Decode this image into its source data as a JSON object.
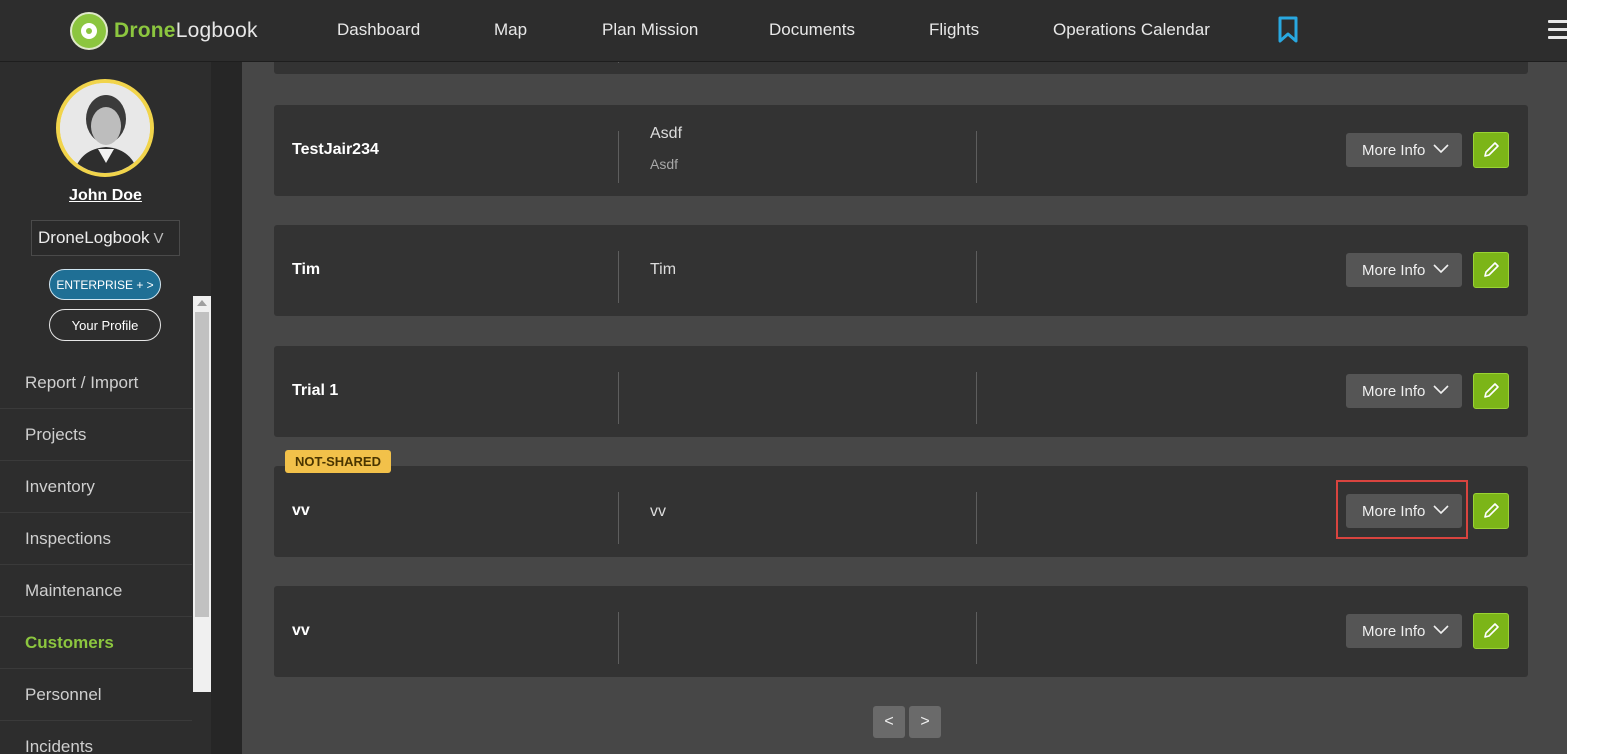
{
  "brand": {
    "part1": "Drone",
    "part2": "Logbook",
    "accent": "#8cc63f"
  },
  "nav": {
    "items": [
      "Dashboard",
      "Map",
      "Plan Mission",
      "Documents",
      "Flights",
      "Operations Calendar"
    ],
    "bookmark_icon": "bookmark-icon",
    "menu_icon": "hamburger-menu-icon"
  },
  "sidebar": {
    "user_name": "John Doe",
    "organization": "DroneLogbook",
    "organization_chevron": "V",
    "plan_button": "ENTERPRISE + >",
    "profile_button": "Your Profile",
    "menu": [
      "Report / Import",
      "Projects",
      "Inventory",
      "Inspections",
      "Maintenance",
      "Customers",
      "Personnel",
      "Incidents"
    ],
    "active_item": "Customers"
  },
  "customers": [
    {
      "name": "TestJair234",
      "detail": "Asdf",
      "detail2": "Asdf",
      "badge": ""
    },
    {
      "name": "Tim",
      "detail": "Tim",
      "detail2": "",
      "badge": ""
    },
    {
      "name": "Trial 1",
      "detail": "",
      "detail2": "",
      "badge": ""
    },
    {
      "name": "vv",
      "detail": "vv",
      "detail2": "",
      "badge": "NOT-SHARED"
    },
    {
      "name": "vv",
      "detail": "",
      "detail2": "",
      "badge": ""
    }
  ],
  "row_actions": {
    "more_info": "More Info",
    "edit_icon": "pencil-icon"
  },
  "pagination": {
    "prev": "<",
    "next": ">"
  },
  "colors": {
    "badge": "#f2c14a",
    "edit": "#7cb518",
    "highlight": "#d9443f",
    "enterprise": "#1f6f95"
  }
}
